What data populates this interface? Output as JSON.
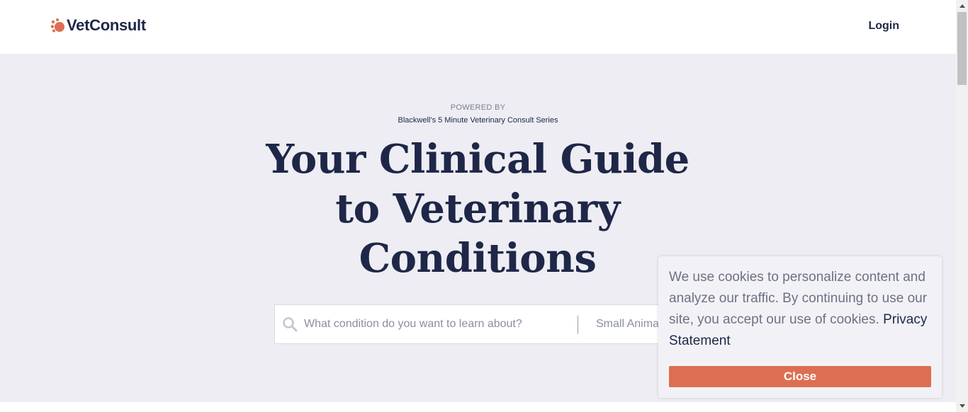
{
  "header": {
    "logo_text": "VetConsult",
    "login_label": "Login"
  },
  "hero": {
    "powered_by": "POWERED BY",
    "series_name": "Blackwell’s 5 Minute Veterinary Consult Series",
    "headline_line1": "Your Clinical Guide",
    "headline_line2": "to Veterinary",
    "headline_line3": "Conditions"
  },
  "search": {
    "placeholder": "What condition do you want to learn about?",
    "species_value": "Small Animal"
  },
  "cookie_banner": {
    "message": "We use cookies to personalize content and analyze our traffic. By continuing to use our site, you accept our use of cookies.",
    "link_label": "Privacy Statement",
    "close_label": "Close"
  },
  "colors": {
    "brand_navy": "#1f2748",
    "brand_orange": "#dd6e51",
    "hero_background": "#ededf3"
  },
  "icons": {
    "logo": "paw-icon",
    "search": "search-icon"
  }
}
